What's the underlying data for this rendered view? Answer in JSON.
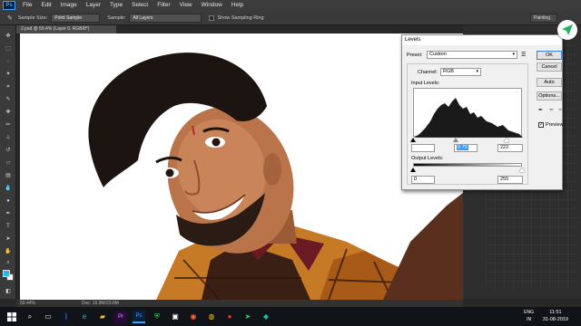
{
  "menu": {
    "logo": "Ps",
    "items": [
      "File",
      "Edit",
      "Image",
      "Layer",
      "Type",
      "Select",
      "Filter",
      "View",
      "Window",
      "Help"
    ]
  },
  "options_bar": {
    "sample_size_label": "Sample Size:",
    "sample_size_value": "Point Sample",
    "sample_label": "Sample:",
    "sample_value": "All Layers",
    "show_ring_label": "Show Sampling Ring",
    "workspace": "Painting"
  },
  "document": {
    "tab_title": "2.psd @ 59.4% (Layer 0, RGB/8*)",
    "zoom": "59.44%",
    "doc_size": "Doc: 16.9M/23.6M"
  },
  "levels_dialog": {
    "title": "Levels",
    "preset_label": "Preset:",
    "preset_value": "Custom",
    "channel_label": "Channel:",
    "channel_value": "RGB",
    "input_label": "Input Levels:",
    "input_black": "",
    "input_gamma": "0.79",
    "input_white": "222",
    "output_label": "Output Levels:",
    "output_black": "0",
    "output_white": "255",
    "buttons": {
      "ok": "OK",
      "cancel": "Cancel",
      "auto": "Auto",
      "options": "Options..."
    },
    "preview_label": "Preview",
    "preview_checked": true
  },
  "taskbar": {
    "lang_1": "ENG",
    "lang_2": "IN",
    "time": "11:51",
    "date": "31-08-2019"
  },
  "colors": {
    "foreground": "#22b8e8",
    "background": "#ffffff",
    "accent": "#31a8ff"
  }
}
